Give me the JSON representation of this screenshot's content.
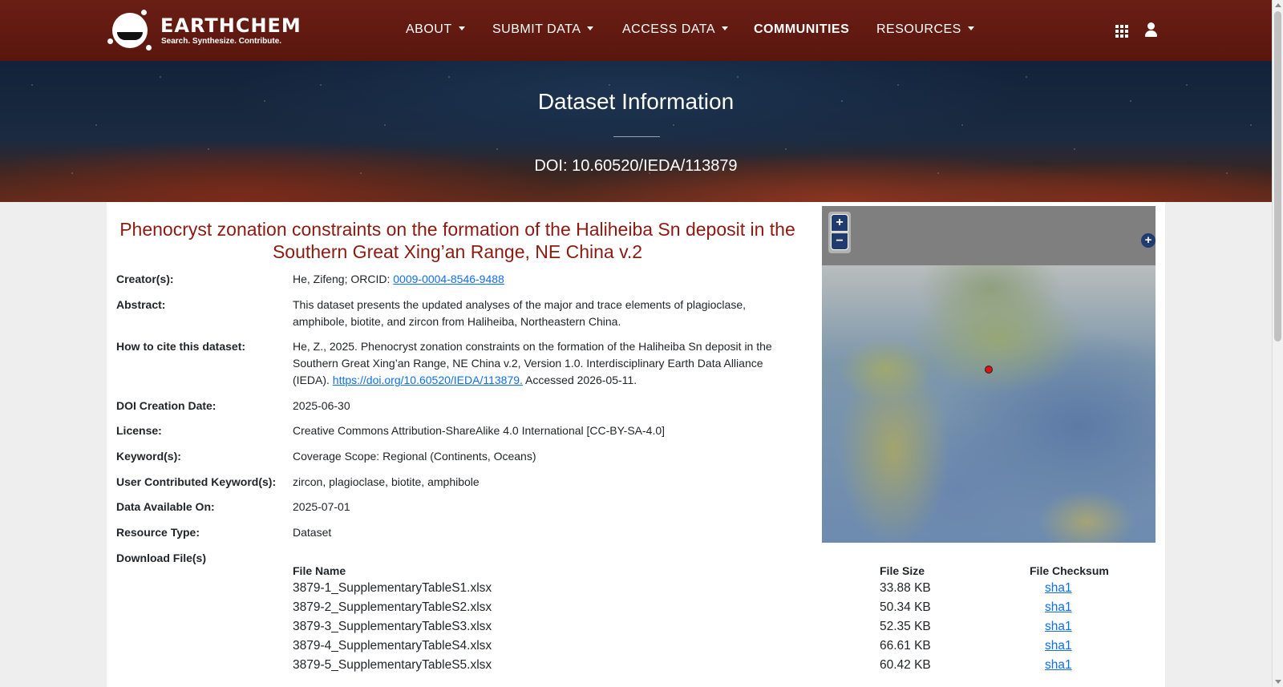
{
  "brand": {
    "name": "EARTHCHEM",
    "tagline": "Search. Synthesize. Contribute."
  },
  "nav": {
    "about": "ABOUT",
    "submit": "SUBMIT DATA",
    "access": "ACCESS DATA",
    "communities": "COMMUNITIES",
    "resources": "RESOURCES",
    "icons": [
      "grid-icon",
      "user-icon"
    ]
  },
  "hero": {
    "title": "Dataset Information",
    "doi": "DOI: 10.60520/IEDA/113879"
  },
  "dataset": {
    "title": "Phenocryst zonation constraints on the formation of the Haliheiba Sn deposit in the Southern Great Xing’an Range, NE China v.2",
    "creators_label": "Creator(s):",
    "creators_text": "He, Zifeng; ORCID: ",
    "creators_orcid": "0009-0004-8546-9488",
    "abstract_label": "Abstract:",
    "abstract": "This dataset presents the updated analyses of the major and trace elements of plagioclase, amphibole, biotite, and zircon from Haliheiba, Northeastern China.",
    "cite_label": "How to cite this dataset:",
    "cite_text": "He, Z., 2025. Phenocryst zonation constraints on the formation of the Haliheiba Sn deposit in the Southern Great Xing’an Range, NE China v.2, Version 1.0. Interdisciplinary Earth Data Alliance (IEDA). ",
    "cite_link": "https://doi.org/10.60520/IEDA/113879.",
    "cite_accessed": " Accessed 2026-05-11.",
    "doi_date_label": "DOI Creation Date:",
    "doi_date": "2025-06-30",
    "license_label": "License:",
    "license": "Creative Commons Attribution-ShareAlike 4.0 International [CC-BY-SA-4.0]",
    "keywords_label": "Keyword(s):",
    "keywords": "Coverage Scope: Regional (Continents, Oceans)",
    "user_keywords_label": "User Contributed Keyword(s):",
    "user_keywords": "zircon, plagioclase, biotite, amphibole",
    "available_label": "Data Available On:",
    "available": "2025-07-01",
    "resource_type_label": "Resource Type:",
    "resource_type": "Dataset",
    "download_label": "Download File(s)"
  },
  "files": {
    "headers": [
      "File Name",
      "File Size",
      "File Checksum"
    ],
    "rows": [
      {
        "name": "3879-1_SupplementaryTableS1.xlsx",
        "size": "33.88 KB",
        "checksum": "sha1"
      },
      {
        "name": "3879-2_SupplementaryTableS2.xlsx",
        "size": "50.34 KB",
        "checksum": "sha1"
      },
      {
        "name": "3879-3_SupplementaryTableS3.xlsx",
        "size": "52.35 KB",
        "checksum": "sha1"
      },
      {
        "name": "3879-4_SupplementaryTableS4.xlsx",
        "size": "66.61 KB",
        "checksum": "sha1"
      },
      {
        "name": "3879-5_SupplementaryTableS5.xlsx",
        "size": "60.42 KB",
        "checksum": "sha1"
      }
    ]
  },
  "map": {
    "zoom_in": "+",
    "zoom_out": "−",
    "expand": "+"
  }
}
